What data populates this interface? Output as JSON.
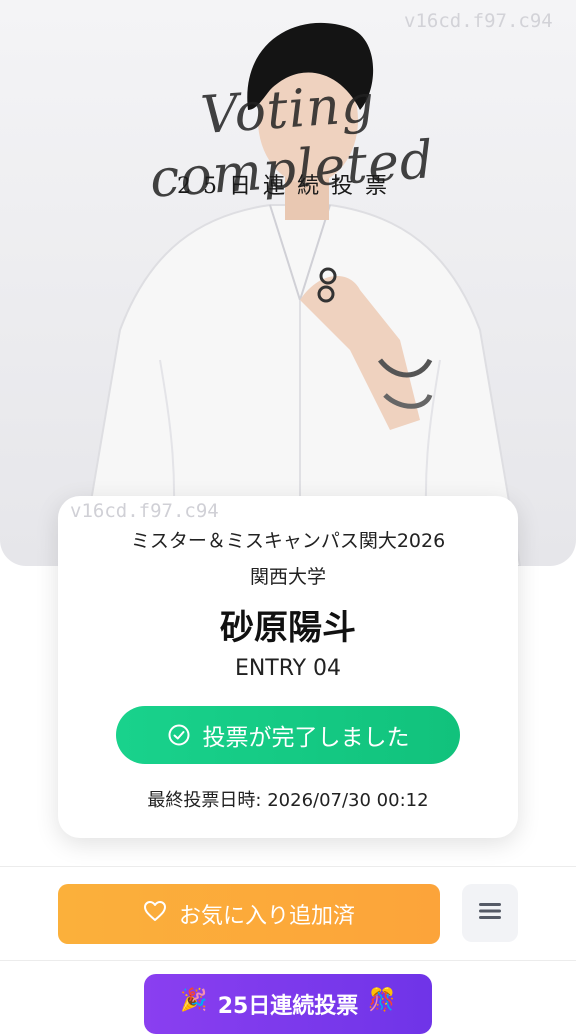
{
  "hero": {
    "watermark": "v16cd.f97.c94",
    "script_title": "Voting completed",
    "sub_title": "25日連続投票"
  },
  "card": {
    "watermark": "v16cd.f97.c94",
    "contest": "ミスター＆ミスキャンパス関大2026",
    "university": "関西大学",
    "name": "砂原陽斗",
    "entry": "ENTRY 04",
    "voted_label": "投票が完了しました",
    "last_vote": "最終投票日時: 2026/07/30 00:12"
  },
  "actions": {
    "favorite_label": "お気に入り追加済",
    "streak_label": "25日連続投票",
    "streak_emoji_left": "🎉",
    "streak_emoji_right": "🎊"
  },
  "colors": {
    "voted_green": "#19d28c",
    "favorite_orange": "#fbb03b",
    "streak_purple": "#7a3aee"
  }
}
